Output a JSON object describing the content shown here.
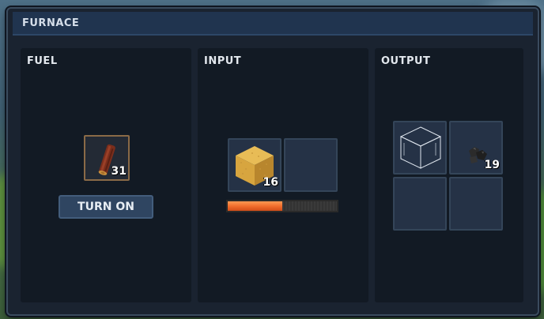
{
  "window": {
    "title": "FURNACE"
  },
  "fuel": {
    "label": "FUEL",
    "item": {
      "icon": "wood-log-icon",
      "count": "31"
    },
    "button_label": "TURN ON"
  },
  "input": {
    "label": "INPUT",
    "slots": [
      {
        "icon": "sand-block-icon",
        "count": "16"
      },
      {
        "icon": null,
        "count": ""
      }
    ],
    "smelt_progress_fraction": 0.5,
    "progress_color": "#f06a2a"
  },
  "output": {
    "label": "OUTPUT",
    "slots": [
      {
        "icon": "glass-block-icon",
        "count": ""
      },
      {
        "icon": "coal-lump-icon",
        "count": "19"
      },
      {
        "icon": null,
        "count": ""
      },
      {
        "icon": null,
        "count": ""
      }
    ]
  }
}
